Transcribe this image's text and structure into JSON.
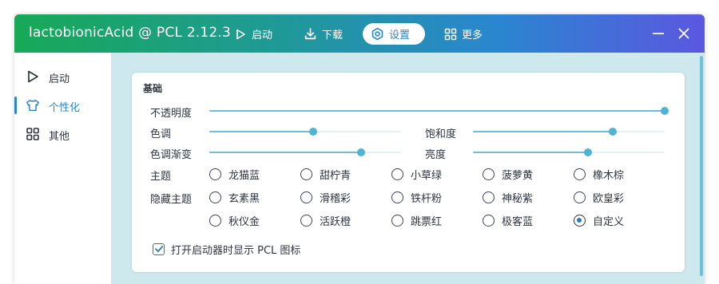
{
  "titlebar": {
    "title": "lactobionicAcid @ PCL 2.12.3",
    "nav": [
      {
        "label": "启动",
        "icon": "play-icon",
        "active": false
      },
      {
        "label": "下载",
        "icon": "download-icon",
        "active": false
      },
      {
        "label": "设置",
        "icon": "settings-icon",
        "active": true
      },
      {
        "label": "更多",
        "icon": "grid-icon",
        "active": false
      }
    ]
  },
  "sidebar": {
    "items": [
      {
        "label": "启动",
        "icon": "play-icon",
        "active": false
      },
      {
        "label": "个性化",
        "icon": "shirt-icon",
        "active": true
      },
      {
        "label": "其他",
        "icon": "grid-icon",
        "active": false
      }
    ]
  },
  "card": {
    "title": "基础",
    "sliders": [
      {
        "label": "不透明度",
        "value": 1.0
      },
      {
        "label": "色调",
        "value": 0.54
      },
      {
        "label": "饱和度",
        "value": 0.73
      },
      {
        "label": "色调渐变",
        "value": 0.79
      },
      {
        "label": "亮度",
        "value": 0.6
      }
    ],
    "theme_label": "主题",
    "hidden_theme_label": "隐藏主题",
    "themes": [
      "龙猫蓝",
      "甜柠青",
      "小草绿",
      "菠萝黄",
      "橡木棕"
    ],
    "hidden_themes_row1": [
      "玄素黑",
      "滑稽彩",
      "铁杆粉",
      "神秘紫",
      "欧皇彩"
    ],
    "hidden_themes_row2": [
      "秋仪金",
      "活跃橙",
      "跳票红",
      "极客蓝",
      "自定义"
    ],
    "selected_theme": "自定义",
    "show_icon_checkbox": {
      "label": "打开启动器时显示 PCL 图标",
      "checked": true
    }
  },
  "colors": {
    "accent": "#2a86cf",
    "slider": "#4fb3d3",
    "background": "#cde9ee"
  }
}
